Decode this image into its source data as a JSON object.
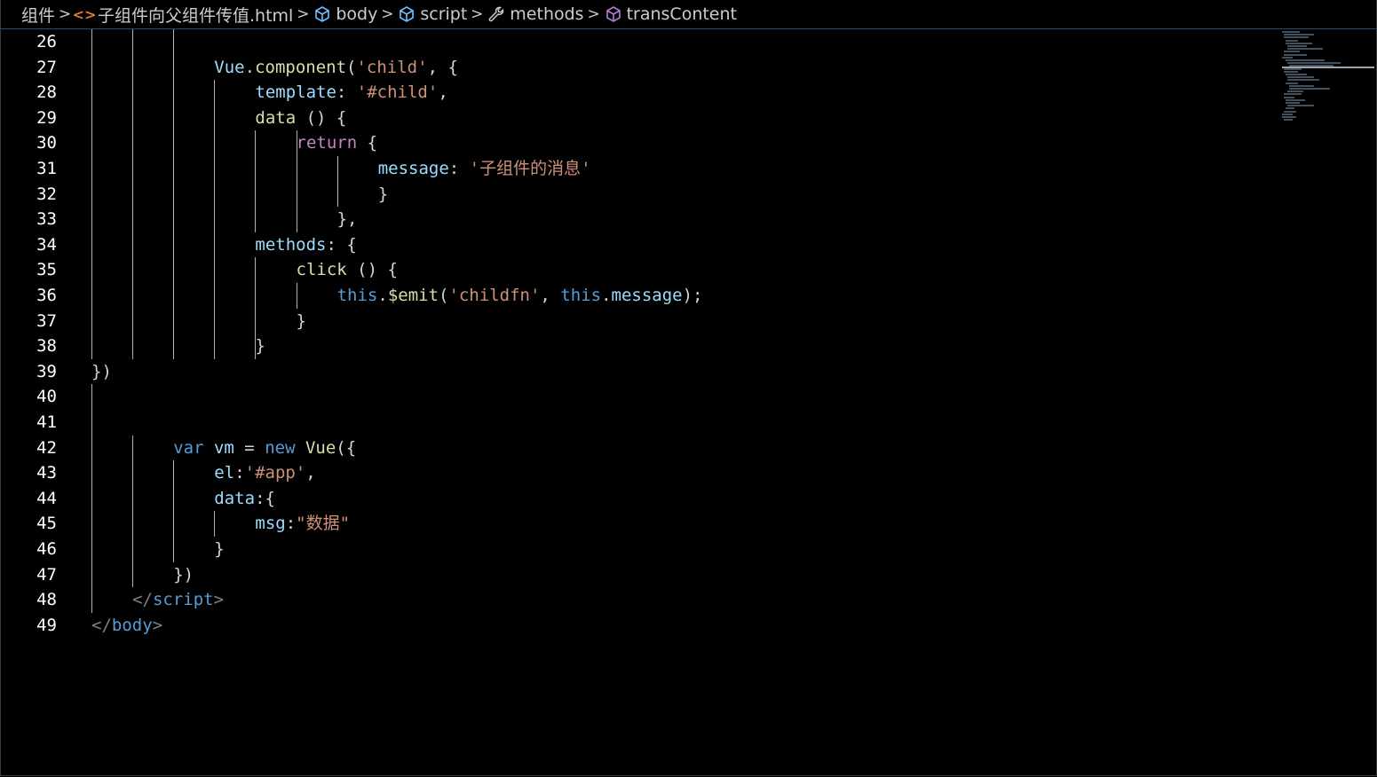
{
  "breadcrumb": {
    "items": [
      {
        "label": "组件",
        "icon": "folder-icon"
      },
      {
        "label": "子组件向父组件传值.html",
        "icon": "html-file-icon"
      },
      {
        "label": "body",
        "icon": "cube-icon"
      },
      {
        "label": "script",
        "icon": "cube-icon"
      },
      {
        "label": "methods",
        "icon": "wrench-icon"
      },
      {
        "label": "transContent",
        "icon": "cube-purple-icon"
      }
    ],
    "separator": ">"
  },
  "editor": {
    "lines": [
      {
        "n": "26",
        "indent": 0,
        "tokens": []
      },
      {
        "n": "27",
        "indent": 3,
        "tokens": [
          [
            "var",
            "Vue"
          ],
          [
            "pun",
            "."
          ],
          [
            "fn",
            "component"
          ],
          [
            "pun",
            "("
          ],
          [
            "str",
            "'child'"
          ],
          [
            "pun",
            ", {"
          ]
        ]
      },
      {
        "n": "28",
        "indent": 4,
        "tokens": [
          [
            "var",
            "template"
          ],
          [
            "pun",
            ": "
          ],
          [
            "str",
            "'#child'"
          ],
          [
            "pun",
            ","
          ]
        ]
      },
      {
        "n": "29",
        "indent": 4,
        "tokens": [
          [
            "fn",
            "data"
          ],
          [
            "pun",
            " () {"
          ]
        ]
      },
      {
        "n": "30",
        "indent": 5,
        "tokens": [
          [
            "ctrl",
            "return"
          ],
          [
            "pun",
            " {"
          ]
        ]
      },
      {
        "n": "31",
        "indent": 7,
        "tokens": [
          [
            "var",
            "message"
          ],
          [
            "pun",
            ": "
          ],
          [
            "str",
            "'子组件的消息'"
          ]
        ]
      },
      {
        "n": "32",
        "indent": 7,
        "tokens": [
          [
            "pun",
            "}"
          ]
        ]
      },
      {
        "n": "33",
        "indent": 6,
        "tokens": [
          [
            "pun",
            "},"
          ]
        ]
      },
      {
        "n": "34",
        "indent": 4,
        "tokens": [
          [
            "var",
            "methods"
          ],
          [
            "pun",
            ": {"
          ]
        ]
      },
      {
        "n": "35",
        "indent": 5,
        "tokens": [
          [
            "fn",
            "click"
          ],
          [
            "pun",
            " () {"
          ]
        ]
      },
      {
        "n": "36",
        "indent": 6,
        "tokens": [
          [
            "kw",
            "this"
          ],
          [
            "pun",
            "."
          ],
          [
            "fn",
            "$emit"
          ],
          [
            "pun",
            "("
          ],
          [
            "str",
            "'childfn'"
          ],
          [
            "pun",
            ", "
          ],
          [
            "kw",
            "this"
          ],
          [
            "pun",
            "."
          ],
          [
            "var",
            "message"
          ],
          [
            "pun",
            ");"
          ]
        ]
      },
      {
        "n": "37",
        "indent": 5,
        "tokens": [
          [
            "pun",
            "}"
          ]
        ]
      },
      {
        "n": "38",
        "indent": 4,
        "tokens": [
          [
            "pun",
            "}"
          ]
        ]
      },
      {
        "n": "39",
        "indent": 0,
        "tokens": [
          [
            "pun",
            "})"
          ]
        ]
      },
      {
        "n": "40",
        "indent": 0,
        "tokens": []
      },
      {
        "n": "41",
        "indent": 0,
        "tokens": []
      },
      {
        "n": "42",
        "indent": 2,
        "tokens": [
          [
            "kw",
            "var"
          ],
          [
            "pun",
            " "
          ],
          [
            "var",
            "vm"
          ],
          [
            "pun",
            " = "
          ],
          [
            "kw",
            "new"
          ],
          [
            "pun",
            " "
          ],
          [
            "fn",
            "Vue"
          ],
          [
            "pun",
            "({"
          ]
        ]
      },
      {
        "n": "43",
        "indent": 3,
        "tokens": [
          [
            "var",
            "el"
          ],
          [
            "pun",
            ":"
          ],
          [
            "str",
            "'#app'"
          ],
          [
            "pun",
            ","
          ]
        ]
      },
      {
        "n": "44",
        "indent": 3,
        "tokens": [
          [
            "var",
            "data"
          ],
          [
            "pun",
            ":{"
          ]
        ]
      },
      {
        "n": "45",
        "indent": 4,
        "tokens": [
          [
            "var",
            "msg"
          ],
          [
            "pun",
            ":"
          ],
          [
            "str",
            "\"数据\""
          ]
        ]
      },
      {
        "n": "46",
        "indent": 3,
        "tokens": [
          [
            "pun",
            "}"
          ]
        ]
      },
      {
        "n": "47",
        "indent": 2,
        "tokens": [
          [
            "pun",
            "})"
          ]
        ]
      },
      {
        "n": "48",
        "indent": 1,
        "tokens": [
          [
            "tag",
            "</"
          ],
          [
            "tagn",
            "script"
          ],
          [
            "tag",
            ">"
          ]
        ]
      },
      {
        "n": "49",
        "indent": 0,
        "tokens": [
          [
            "tag",
            "</"
          ],
          [
            "tagn",
            "body"
          ],
          [
            "tag",
            ">"
          ]
        ]
      }
    ],
    "guides": [
      {
        "col": 0,
        "from": 0,
        "to": 12
      },
      {
        "col": 1,
        "from": 0,
        "to": 12
      },
      {
        "col": 2,
        "from": 0,
        "to": 12
      },
      {
        "col": 3,
        "from": 2,
        "to": 12
      },
      {
        "col": 4,
        "from": 4,
        "to": 7
      },
      {
        "col": 5,
        "from": 4,
        "to": 7
      },
      {
        "col": 6,
        "from": 5,
        "to": 6
      },
      {
        "col": 4,
        "from": 9,
        "to": 12
      },
      {
        "col": 5,
        "from": 10,
        "to": 10
      },
      {
        "col": 0,
        "from": 14,
        "to": 22
      },
      {
        "col": 1,
        "from": 16,
        "to": 21
      },
      {
        "col": 2,
        "from": 17,
        "to": 20
      },
      {
        "col": 3,
        "from": 19,
        "to": 19
      }
    ]
  }
}
